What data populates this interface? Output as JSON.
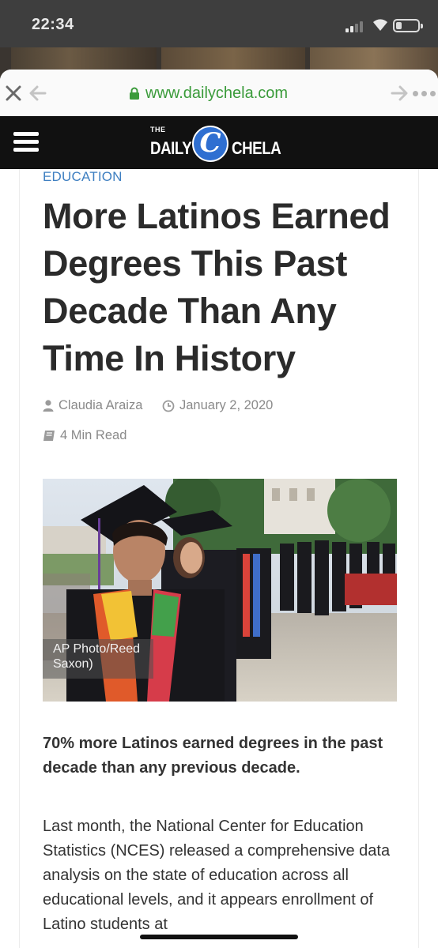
{
  "status_bar": {
    "time": "22:34"
  },
  "browser": {
    "url": "www.dailychela.com",
    "close_icon": "close-icon",
    "back_icon": "arrow-left-icon",
    "forward_icon": "arrow-right-icon",
    "more_icon": "more-icon",
    "secure_icon": "lock-icon"
  },
  "site": {
    "logo_the": "THE",
    "logo_daily": "DAILY",
    "logo_c": "C",
    "logo_chela": "CHELA",
    "menu_icon": "hamburger-icon",
    "brand_color": "#2f6fd1"
  },
  "article": {
    "category": "EDUCATION",
    "title": "More Latinos Earned Degrees This Past Decade Than Any Time In History",
    "author": "Claudia Araiza",
    "date": "January 2, 2020",
    "read_time": "4 Min Read",
    "photo_caption": "AP Photo/Reed Saxon)",
    "lede": "70% more Latinos earned degrees in the past decade than any previous decade.",
    "body": "Last month, the National Center for Education Statistics (NCES) released a comprehensive data analysis on the state of education across all educational levels, and it appears enrollment of Latino students at"
  },
  "colors": {
    "category": "#3e7fc1",
    "url_green": "#3a9b3a",
    "header_bg": "#111111"
  }
}
